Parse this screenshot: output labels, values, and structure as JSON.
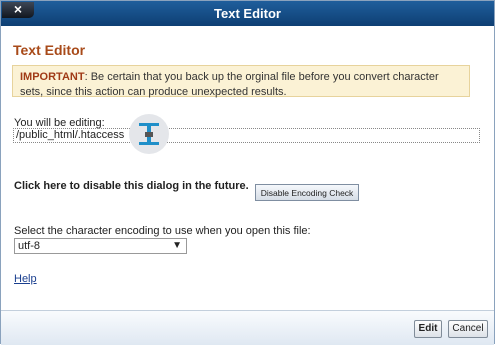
{
  "titlebar": {
    "title": "Text Editor",
    "close_label": "×"
  },
  "heading": "Text Editor",
  "warning": {
    "strong": "IMPORTANT",
    "text": ": Be certain that you back up the orginal file before you convert character sets, since this action can produce unexpected results."
  },
  "editing": {
    "label": "You will be editing:",
    "file": "/public_html/.htaccess"
  },
  "disable": {
    "text": "Click here to disable this dialog in the future.",
    "button": "Disable Encoding Check"
  },
  "encoding": {
    "label": "Select the character encoding to use when you open this file:",
    "selected": "utf-8"
  },
  "help": "Help",
  "footer": {
    "edit": "Edit",
    "cancel": "Cancel"
  },
  "colors": {
    "titlebar": "#1a5794",
    "heading": "#a84a19",
    "warning_bg": "#fbf2d5",
    "important": "#a03a16"
  }
}
